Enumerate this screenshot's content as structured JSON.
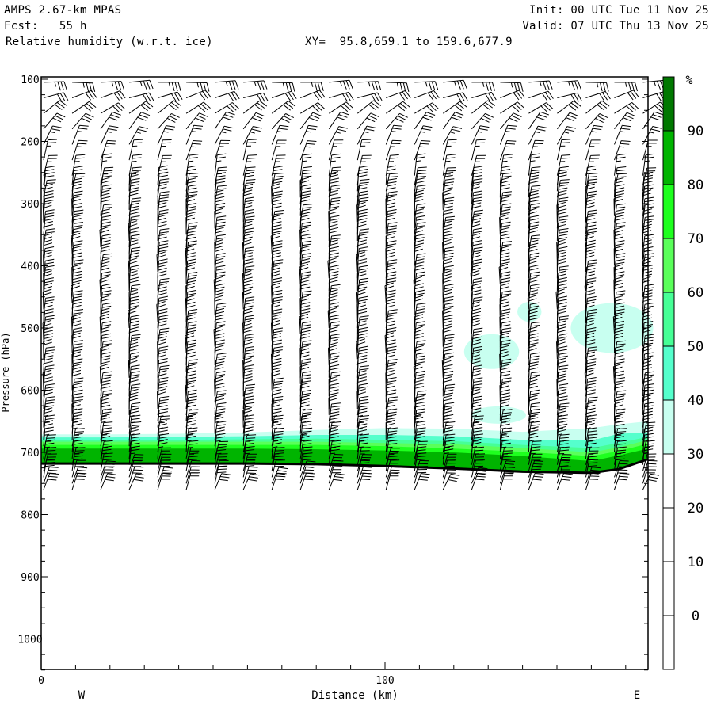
{
  "header": {
    "model": "AMPS 2.67-km MPAS",
    "forecast": "Fcst:   55 h",
    "field": "Relative humidity (w.r.t. ice)",
    "xy": "XY=  95.8,659.1 to 159.6,677.9",
    "init": "Init: 00 UTC Tue 11 Nov 25",
    "valid": "Valid: 07 UTC Thu 13 Nov 25"
  },
  "chart_data": {
    "type": "heatmap",
    "title": "Relative humidity (w.r.t. ice)",
    "xlabel": "Distance (km)",
    "ylabel": "Pressure (hPa)",
    "xlim": [
      0,
      176.5
    ],
    "ylim": [
      1050,
      96
    ],
    "x_ticks": [
      {
        "value": 0,
        "label": "0"
      },
      {
        "value": 100,
        "label": "100"
      }
    ],
    "x_minor_step": 10,
    "y_ticks": [
      {
        "value": 100,
        "label": "100"
      },
      {
        "value": 200,
        "label": "200"
      },
      {
        "value": 300,
        "label": "300"
      },
      {
        "value": 400,
        "label": "400"
      },
      {
        "value": 500,
        "label": "500"
      },
      {
        "value": 600,
        "label": "600"
      },
      {
        "value": 700,
        "label": "700"
      },
      {
        "value": 800,
        "label": "800"
      },
      {
        "value": 900,
        "label": "900"
      },
      {
        "value": 1000,
        "label": "1000"
      }
    ],
    "y_minor_step": 25,
    "direction_left": "W",
    "direction_right": "E",
    "colorbar": {
      "unit": "%",
      "levels": [
        "0",
        "10",
        "20",
        "30",
        "40",
        "50",
        "60",
        "70",
        "80",
        "90"
      ],
      "colors": [
        "#ffffff",
        "#ffffff",
        "#ffffff",
        "#ffffff",
        "#c8fff0",
        "#55ffcc",
        "#46ff96",
        "#5aff5a",
        "#1eff1e",
        "#00b400",
        "#007800"
      ]
    },
    "profile_km": [
      0,
      20,
      40,
      60,
      80,
      100,
      120,
      140,
      160,
      168,
      176.5
    ],
    "terrain_hpa": [
      718,
      718,
      718,
      718,
      719,
      722,
      726,
      731,
      733,
      727,
      711
    ],
    "rh_layers": [
      {
        "min_rh": 30,
        "color": "#c8fff0",
        "top_hpa": [
          671,
          671,
          670,
          668,
          664,
          661,
          662,
          667,
          661,
          655,
          650
        ]
      },
      {
        "min_rh": 40,
        "color": "#55ffcc",
        "top_hpa": [
          676,
          676,
          675,
          674,
          672,
          672,
          674,
          680,
          681,
          670,
          668
        ]
      },
      {
        "min_rh": 50,
        "color": "#46ff96",
        "top_hpa": [
          680,
          680,
          680,
          679,
          678,
          680,
          682,
          688,
          693,
          685,
          675
        ]
      },
      {
        "min_rh": 60,
        "color": "#5aff5a",
        "top_hpa": [
          683,
          683,
          683,
          683,
          683,
          685,
          687,
          693,
          700,
          692,
          680
        ]
      },
      {
        "min_rh": 70,
        "color": "#1eff1e",
        "top_hpa": [
          688,
          688,
          688,
          688,
          688,
          690,
          694,
          699,
          706,
          698,
          686
        ]
      },
      {
        "min_rh": 80,
        "color": "#00b400",
        "top_hpa": [
          694,
          694,
          694,
          694,
          695,
          697,
          700,
          706,
          714,
          705,
          694
        ]
      }
    ],
    "rh_patches_30": [
      {
        "km": 131,
        "hpa": 538,
        "rkm": 8,
        "rhpa": 28
      },
      {
        "km": 142,
        "hpa": 474,
        "rkm": 3.5,
        "rhpa": 16
      },
      {
        "km": 166,
        "hpa": 500,
        "rkm": 12,
        "rhpa": 40
      },
      {
        "km": 133,
        "hpa": 640,
        "rkm": 8,
        "rhpa": 14
      }
    ],
    "wind_profile": [
      {
        "hpa": 105,
        "dir": 88,
        "kt": 35
      },
      {
        "hpa": 130,
        "dir": 72,
        "kt": 30
      },
      {
        "hpa": 155,
        "dir": 55,
        "kt": 30
      },
      {
        "hpa": 180,
        "dir": 38,
        "kt": 30
      },
      {
        "hpa": 205,
        "dir": 25,
        "kt": 25
      },
      {
        "hpa": 240,
        "dir": 12,
        "kt": 25
      },
      {
        "hpa": 300,
        "dir": 4,
        "kt": 20
      },
      {
        "hpa": 450,
        "dir": 2,
        "kt": 20
      },
      {
        "hpa": 600,
        "dir": 3,
        "kt": 20
      },
      {
        "hpa": 700,
        "dir": 6,
        "kt": 25
      },
      {
        "hpa": 760,
        "dir": 20,
        "kt": 30
      }
    ],
    "barb_levels_upper": [
      105,
      130,
      155,
      180,
      205,
      230,
      255
    ],
    "barb_levels_regular": {
      "from": 270,
      "to": 760,
      "step": 10
    },
    "barb_columns": {
      "start_km": 0.7,
      "step_km": 8.3,
      "count": 22
    }
  }
}
